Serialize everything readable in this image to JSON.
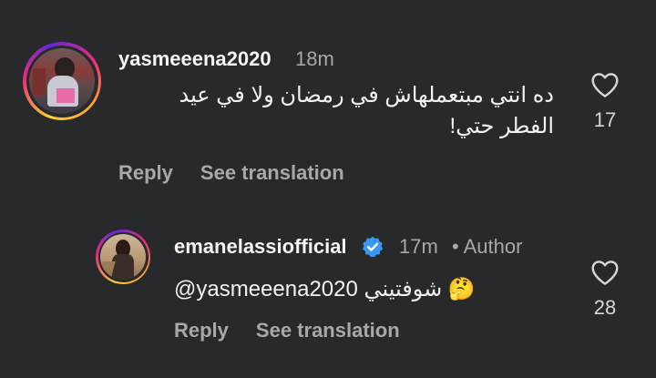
{
  "comments": [
    {
      "username": "yasmeeena2020",
      "time": "18m",
      "text_line1": "ده انتي مبتعملهاش في رمضان ولا في عيد",
      "text_line2": "الفطر حتي!",
      "likes": "17",
      "reply": "Reply",
      "see_translation": "See translation"
    },
    {
      "username": "emanelassiofficial",
      "time": "17m",
      "author_label": "• Author",
      "mention": "@yasmeeena2020",
      "text": "شوفتيني",
      "emoji": "🤔",
      "likes": "28",
      "reply": "Reply",
      "see_translation": "See translation"
    }
  ],
  "colors": {
    "background": "#28292b",
    "verified": "#3897f0"
  },
  "icons": [
    "heart-outline-icon",
    "verified-badge-icon",
    "thinking-face-emoji"
  ]
}
